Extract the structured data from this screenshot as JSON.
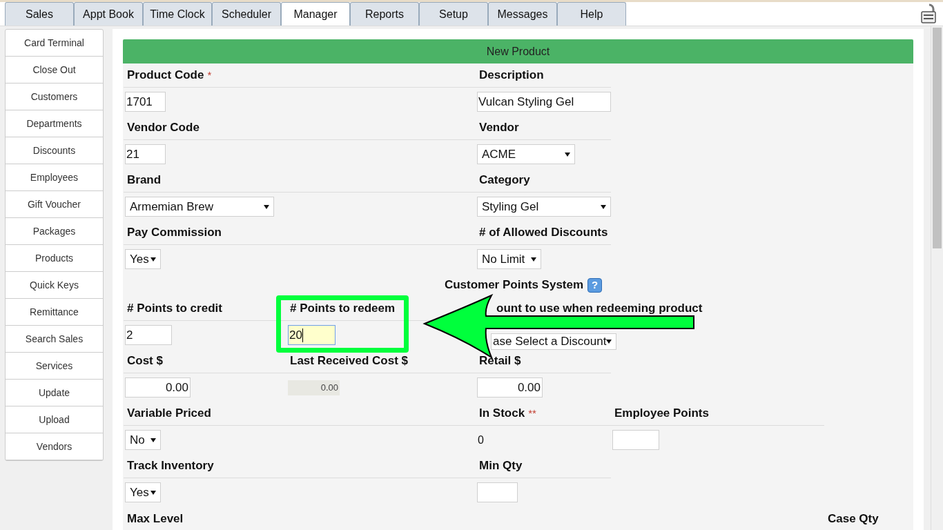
{
  "tabs": [
    {
      "label": "Sales",
      "selected": false
    },
    {
      "label": "Appt Book",
      "selected": false
    },
    {
      "label": "Time Clock",
      "selected": false
    },
    {
      "label": "Scheduler",
      "selected": false
    },
    {
      "label": "Manager",
      "selected": true
    },
    {
      "label": "Reports",
      "selected": false
    },
    {
      "label": "Setup",
      "selected": false
    },
    {
      "label": "Messages",
      "selected": false
    },
    {
      "label": "Help",
      "selected": false
    }
  ],
  "sidebar": {
    "items": [
      {
        "label": "Card Terminal"
      },
      {
        "label": "Close Out"
      },
      {
        "label": "Customers"
      },
      {
        "label": "Departments"
      },
      {
        "label": "Discounts"
      },
      {
        "label": "Employees"
      },
      {
        "label": "Gift Voucher"
      },
      {
        "label": "Packages"
      },
      {
        "label": "Products"
      },
      {
        "label": "Quick Keys"
      },
      {
        "label": "Remittance"
      },
      {
        "label": "Search Sales"
      },
      {
        "label": "Services"
      },
      {
        "label": "Update"
      },
      {
        "label": "Upload"
      },
      {
        "label": "Vendors"
      }
    ]
  },
  "form": {
    "title": "New Product",
    "rows": [
      {
        "kind": "fields",
        "cells": [
          {
            "kind": "text",
            "label": "Product Code",
            "marker": "*",
            "value": "1701"
          },
          {
            "kind": "empty"
          },
          {
            "kind": "text",
            "label": "Description",
            "value": "Vulcan Styling Gel"
          }
        ]
      },
      {
        "kind": "fields",
        "cells": [
          {
            "kind": "text",
            "label": "Vendor Code",
            "value": "21"
          },
          {
            "kind": "empty"
          },
          {
            "kind": "select",
            "label": "Vendor",
            "value": "ACME"
          }
        ]
      },
      {
        "kind": "fields",
        "cells": [
          {
            "kind": "select",
            "label": "Brand",
            "value": "Armemian Brew"
          },
          {
            "kind": "empty"
          },
          {
            "kind": "select",
            "label": "Category",
            "value": "Styling Gel"
          }
        ]
      },
      {
        "kind": "fields",
        "cells": [
          {
            "kind": "select",
            "label": "Pay Commission",
            "value": "Yes"
          },
          {
            "kind": "empty"
          },
          {
            "kind": "select",
            "label": "# of Allowed Discounts",
            "value": "No Limit"
          }
        ]
      },
      {
        "kind": "section",
        "title": "Customer Points System",
        "help": "?"
      },
      {
        "kind": "fields",
        "cells": [
          {
            "kind": "text",
            "label": "# Points to credit",
            "value": "2"
          },
          {
            "kind": "text",
            "label": "# Points to redeem",
            "value": "20",
            "highlighted": true,
            "focused": true
          },
          {
            "kind": "select",
            "label": "ount to use when redeeming product",
            "value": "ase Select a Discount"
          }
        ]
      },
      {
        "kind": "fields",
        "cells": [
          {
            "kind": "number",
            "label": "Cost $",
            "value": "0.00"
          },
          {
            "kind": "readonly",
            "label": "Last Received Cost $",
            "value": "0.00"
          },
          {
            "kind": "number",
            "label": "Retail $",
            "value": "0.00"
          }
        ]
      },
      {
        "kind": "fields",
        "cells": [
          {
            "kind": "select",
            "label": "Variable Priced",
            "value": "No"
          },
          {
            "kind": "empty"
          },
          {
            "kind": "static",
            "label": "In Stock",
            "marker": "**",
            "value": "0"
          },
          {
            "kind": "text",
            "label": "Employee Points"
          }
        ]
      },
      {
        "kind": "fields",
        "cells": [
          {
            "kind": "select",
            "label": "Track Inventory",
            "value": "Yes"
          },
          {
            "kind": "empty"
          },
          {
            "kind": "text",
            "label": "Min Qty"
          }
        ]
      },
      {
        "kind": "labels",
        "cells": [
          {
            "kind": "text",
            "label": "Max Level"
          },
          {
            "kind": "empty"
          },
          {
            "kind": "empty"
          },
          {
            "kind": "empty"
          },
          {
            "kind": "text",
            "label": "Case Qty"
          }
        ]
      }
    ]
  }
}
